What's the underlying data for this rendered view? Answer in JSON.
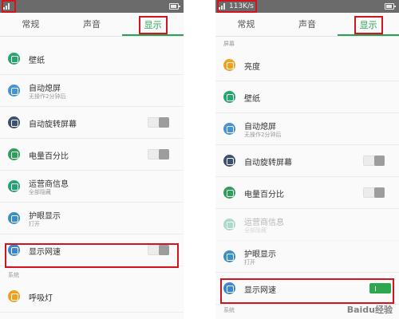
{
  "left": {
    "tabs": [
      "常规",
      "声音",
      "显示"
    ],
    "rows": [
      {
        "label": "壁纸",
        "icon": "wallpaper-icon",
        "color": "#26a66a"
      },
      {
        "label": "自动熄屏",
        "sub": "无操作2分钟后",
        "icon": "screen-timeout-icon",
        "color": "#4592d6"
      },
      {
        "label": "自动旋转屏幕",
        "icon": "rotate-icon",
        "color": "#3d4f73",
        "toggle": "off"
      },
      {
        "label": "电量百分比",
        "icon": "battery-icon",
        "color": "#2f9e5a",
        "toggle": "off"
      },
      {
        "label": "运营商信息",
        "sub": "全部隐藏",
        "icon": "carrier-icon",
        "color": "#22a36f"
      },
      {
        "label": "护眼显示",
        "sub": "打开",
        "icon": "eye-care-icon",
        "color": "#3b8fc7"
      },
      {
        "label": "显示网速",
        "icon": "net-speed-icon",
        "color": "#3a86d0",
        "toggle": "off"
      }
    ],
    "section_label": "系统",
    "last_row": {
      "label": "呼吸灯",
      "icon": "breathing-light-icon",
      "color": "#f0a020"
    }
  },
  "right": {
    "status_speed": "113K/s",
    "tabs": [
      "常规",
      "声音",
      "显示"
    ],
    "section_label": "屏幕",
    "rows": [
      {
        "label": "亮度",
        "icon": "brightness-icon",
        "color": "#f0a020"
      },
      {
        "label": "壁纸",
        "icon": "wallpaper-icon",
        "color": "#26a66a"
      },
      {
        "label": "自动熄屏",
        "sub": "无操作2分钟后",
        "icon": "screen-timeout-icon",
        "color": "#4592d6"
      },
      {
        "label": "自动旋转屏幕",
        "icon": "rotate-icon",
        "color": "#3d4f73",
        "toggle": "off"
      },
      {
        "label": "电量百分比",
        "icon": "battery-icon",
        "color": "#2f9e5a",
        "toggle": "off"
      },
      {
        "label": "运营商信息",
        "sub": "全部隐藏",
        "icon": "carrier-icon",
        "color": "#22a36f",
        "disabled": true
      },
      {
        "label": "护眼显示",
        "sub": "打开",
        "icon": "eye-care-icon",
        "color": "#3b8fc7"
      },
      {
        "label": "显示网速",
        "icon": "net-speed-icon",
        "color": "#3a86d0",
        "toggle": "on"
      }
    ],
    "section_label_bottom": "系统"
  },
  "watermark": "Baidu经验",
  "colors": {
    "accent": "#2aa056",
    "highlight": "#d0151e"
  }
}
